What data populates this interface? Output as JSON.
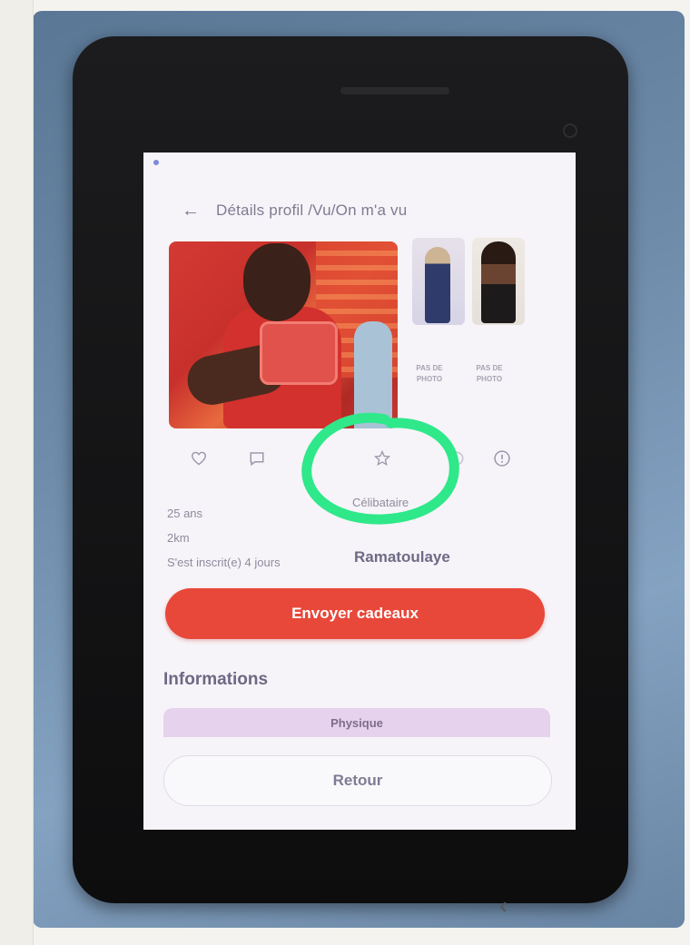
{
  "header": {
    "title": "Détails profil /Vu/On m'a vu"
  },
  "photos": {
    "no_photo_label_1": "PAS DE PHOTO",
    "no_photo_label_2": "PAS DE PHOTO"
  },
  "actions": {
    "icons": [
      "heart-icon",
      "chat-icon",
      "star-icon",
      "gift-icon",
      "info-icon"
    ]
  },
  "profile": {
    "age": "25 ans",
    "distance": "2km",
    "registered": "S'est inscrit(e) 4 jours",
    "status": "Célibataire",
    "name": "Ramatoulaye"
  },
  "buttons": {
    "send_gifts": "Envoyer cadeaux",
    "back": "Retour"
  },
  "info": {
    "section_title": "Informations",
    "physique_label": "Physique"
  },
  "colors": {
    "accent": "#e8483a",
    "chip": "#e6d2ec",
    "annotation": "#2ee88a"
  }
}
